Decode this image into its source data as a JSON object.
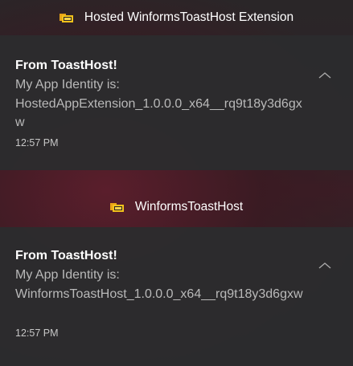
{
  "groups": [
    {
      "app_name": "Hosted WinformsToastHost Extension",
      "app_icon": "folder-icon",
      "notification": {
        "title": "From ToastHost!",
        "body_line1": "My App Identity is:",
        "body_line2": "HostedAppExtension_1.0.0.0_x64__rq9t18y3d6gxw",
        "time": "12:57 PM",
        "collapse_icon": "chevron-up-icon"
      }
    },
    {
      "app_name": "WinformsToastHost",
      "app_icon": "folder-icon",
      "notification": {
        "title": "From ToastHost!",
        "body_line1": "My App Identity is:",
        "body_line2": "WinformsToastHost_1.0.0.0_x64__rq9t18y3d6gxw",
        "time": "12:57 PM",
        "collapse_icon": "chevron-up-icon"
      }
    }
  ],
  "colors": {
    "icon_yellow": "#f2c21b",
    "icon_orange": "#e8a317"
  }
}
